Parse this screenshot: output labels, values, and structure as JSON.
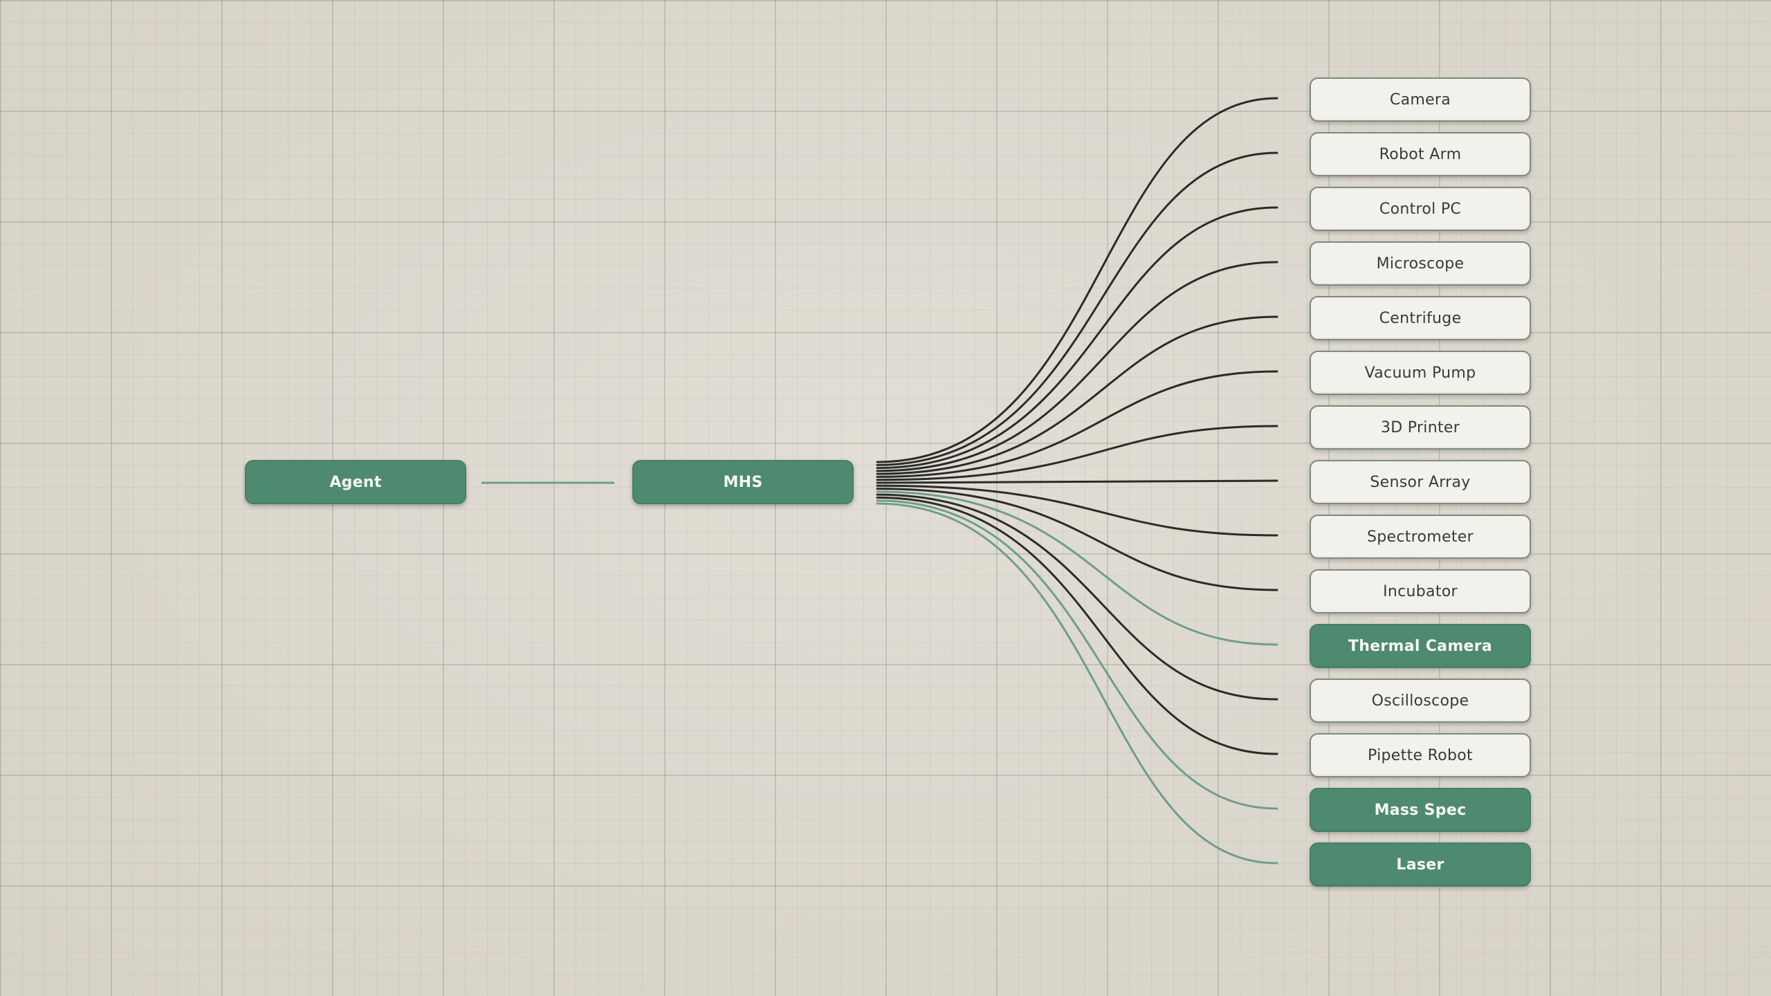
{
  "diagram": {
    "agent_label": "Agent",
    "hub_label": "MHS",
    "devices": [
      {
        "label": "Camera",
        "active": false
      },
      {
        "label": "Robot Arm",
        "active": false
      },
      {
        "label": "Control PC",
        "active": false
      },
      {
        "label": "Microscope",
        "active": false
      },
      {
        "label": "Centrifuge",
        "active": false
      },
      {
        "label": "Vacuum Pump",
        "active": false
      },
      {
        "label": "3D Printer",
        "active": false
      },
      {
        "label": "Sensor Array",
        "active": false
      },
      {
        "label": "Spectrometer",
        "active": false
      },
      {
        "label": "Incubator",
        "active": false
      },
      {
        "label": "Thermal Camera",
        "active": true
      },
      {
        "label": "Oscilloscope",
        "active": false
      },
      {
        "label": "Pipette Robot",
        "active": false
      },
      {
        "label": "Mass Spec",
        "active": true
      },
      {
        "label": "Laser",
        "active": true
      }
    ]
  },
  "colors": {
    "active_fill": "#4e8a70",
    "inactive_fill": "#f2f1ec",
    "wire_inactive": "#2b2b28",
    "wire_active": "#6f9e86",
    "background": "#dedad0"
  }
}
